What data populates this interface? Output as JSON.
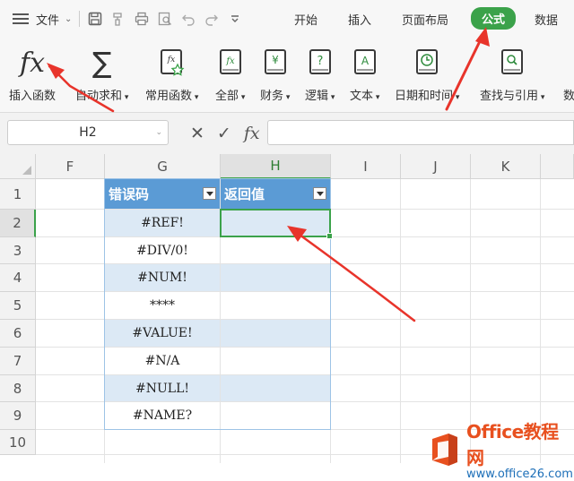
{
  "menubar": {
    "file_label": "文件",
    "tabs": [
      "开始",
      "插入",
      "页面布局",
      "公式",
      "数据"
    ],
    "active_tab": "公式"
  },
  "ribbon": {
    "buttons": [
      {
        "label": "插入函数",
        "icon": "fx-icon"
      },
      {
        "label": "自动求和",
        "icon": "sum-icon"
      },
      {
        "label": "常用函数",
        "icon": "common-functions-icon"
      },
      {
        "label": "全部",
        "icon": "all-functions-icon"
      },
      {
        "label": "财务",
        "icon": "finance-icon"
      },
      {
        "label": "逻辑",
        "icon": "logic-icon"
      },
      {
        "label": "文本",
        "icon": "text-icon"
      },
      {
        "label": "日期和时间",
        "icon": "date-time-icon"
      },
      {
        "label": "查找与引用",
        "icon": "lookup-icon"
      },
      {
        "label": "数",
        "icon": ""
      }
    ]
  },
  "formula_bar": {
    "name_box": "H2",
    "formula": ""
  },
  "grid": {
    "columns": [
      "F",
      "G",
      "H",
      "I",
      "J",
      "K"
    ],
    "rows": [
      "1",
      "2",
      "3",
      "4",
      "5",
      "6",
      "7",
      "8",
      "9",
      "10"
    ],
    "selected_column": "H",
    "selected_row": "2",
    "table": {
      "headers": [
        "错误码",
        "返回值"
      ],
      "error_codes": [
        "#REF!",
        "#DIV/0!",
        "#NUM!",
        "****",
        "#VALUE!",
        "#N/A",
        "#NULL!",
        "#NAME?"
      ]
    }
  },
  "colors": {
    "accent_green": "#3ba24a",
    "table_header": "#5b9bd5",
    "table_band": "#dce9f5",
    "arrow_red": "#e8342b"
  },
  "watermark": {
    "title": "Office教程网",
    "url": "www.office26.com"
  }
}
